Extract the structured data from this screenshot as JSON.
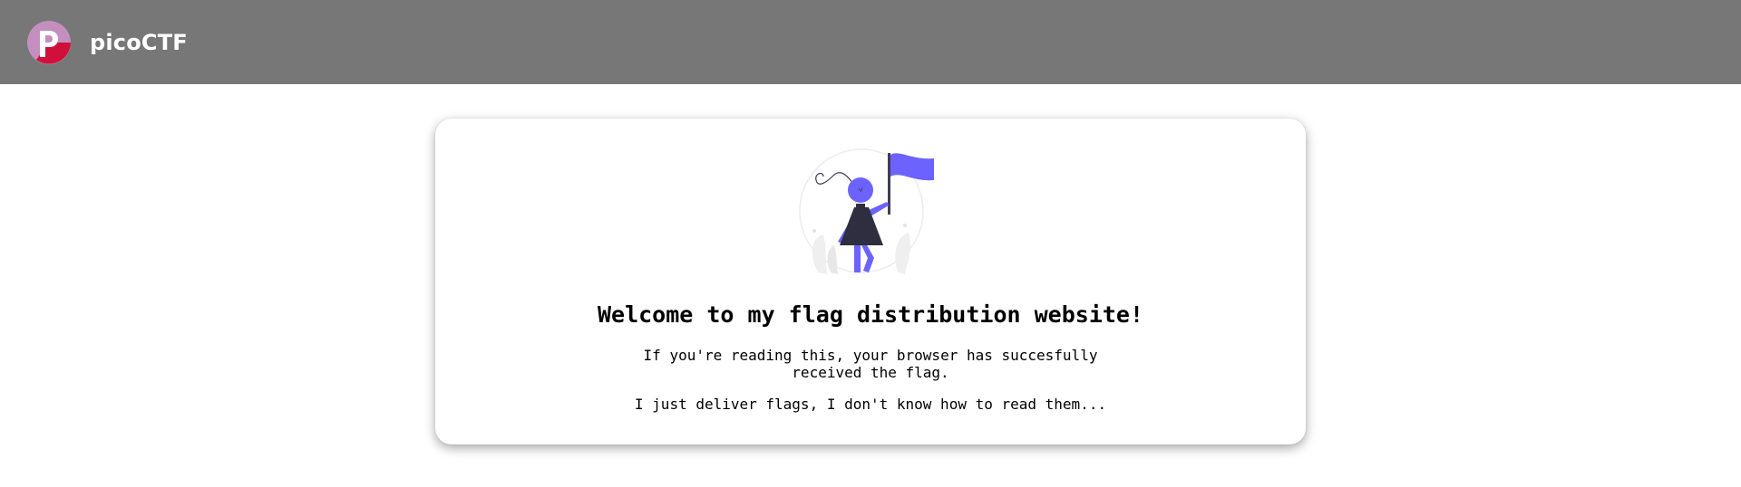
{
  "navbar": {
    "brand_name": "picoCTF",
    "logo_icon": "picoctf-logo-icon",
    "background_color": "#777777"
  },
  "card": {
    "illustration": "girl-holding-flag-illustration",
    "title": "Welcome to my flag distribution website!",
    "paragraph_1": "If you're reading this, your browser has succesfully received the flag.",
    "paragraph_2": "I just deliver flags, I don't know how to read them...",
    "accent_color": "#6c63ff"
  }
}
